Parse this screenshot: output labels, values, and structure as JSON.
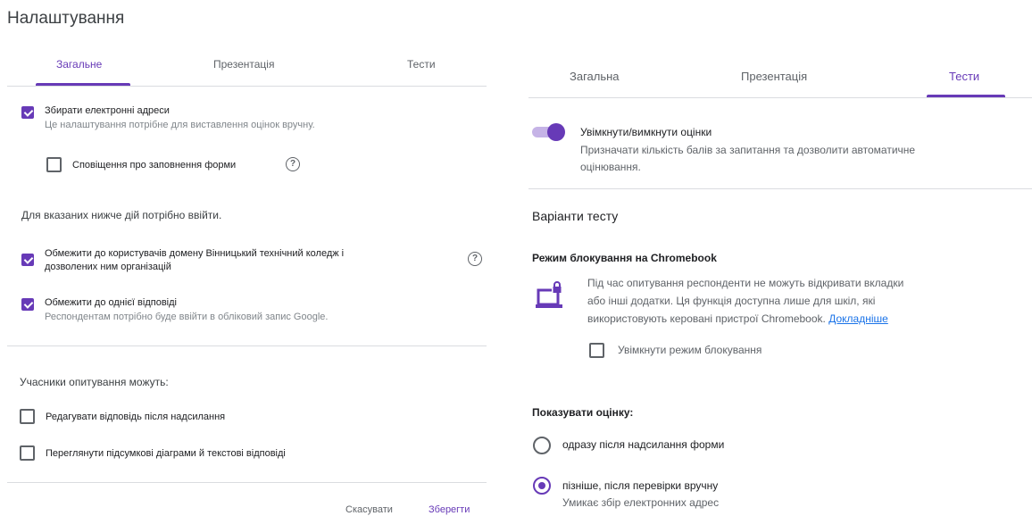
{
  "left": {
    "title": "Налаштування",
    "tabs": [
      "Загальне",
      "Презентація",
      "Тести"
    ],
    "collect_emails": {
      "label": "Збирати електронні адреси",
      "description": "Це налаштування потрібне для виставлення оцінок вручну.",
      "checked": true
    },
    "submission_notifications": {
      "label": "Сповіщення про заповнення форми",
      "checked": false
    },
    "sign_in_heading": "Для вказаних нижче дій потрібно ввійти.",
    "restrict_domain": {
      "label_line1": "Обмежити до користувачів домену Вінницький технічний коледж і",
      "label_line2": "дозволених ним організацій",
      "checked": true
    },
    "limit_one_response": {
      "label": "Обмежити до однієї відповіді",
      "description": "Респондентам потрібно буде ввійти в обліковий запис Google.",
      "checked": true
    },
    "respondents_heading": "Учасники опитування можуть:",
    "edit_after_submit": {
      "label": "Редагувати відповідь після надсилання",
      "checked": false
    },
    "see_summary": {
      "label": "Переглянути підсумкові діаграми й текстові відповіді",
      "checked": false
    },
    "cancel_label": "Скасувати",
    "save_label": "Зберегти"
  },
  "right": {
    "tabs": [
      "Загальна",
      "Презентація",
      "Тести"
    ],
    "quiz_toggle": {
      "label": "Увімкнути/вимкнути оцінки",
      "description_line1": "Призначати кількість балів за запитання та дозволити автоматичне",
      "description_line2": "оцінювання.",
      "on": true
    },
    "quiz_options_heading": "Варіанти тесту",
    "locked_mode": {
      "heading": "Режим блокування на Chromebook",
      "text_line1": "Під час опитування респонденти не можуть відкривати вкладки",
      "text_line2": "або інші додатки. Ця функція доступна лише для шкіл, які",
      "text_line3": "використовують керовані пристрої Chromebook.",
      "link": "Докладніше",
      "checkbox_label": "Увімкнути режим блокування",
      "checked": false
    },
    "release_grade": {
      "heading": "Показувати оцінку:",
      "option1": "одразу після надсилання форми",
      "option2": "пізніше, після перевірки вручну",
      "option2_description": "Умикає збір електронних адрес",
      "selected": 2
    }
  },
  "colors": {
    "accent": "#673ab7",
    "link": "#1a73e8",
    "text": "#202124",
    "muted": "#5f6368"
  }
}
